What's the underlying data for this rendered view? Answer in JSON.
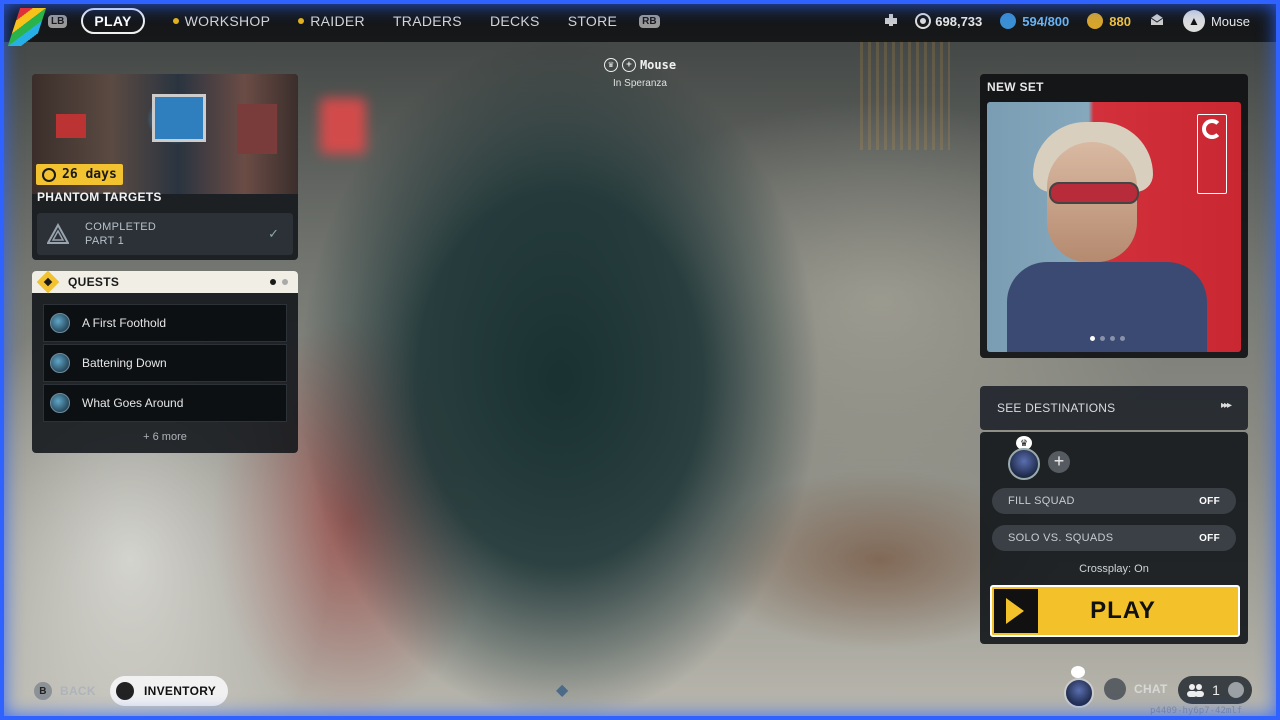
{
  "topbar": {
    "lb": "LB",
    "rb": "RB",
    "tabs": [
      {
        "label": "PLAY",
        "active": true,
        "dot": false
      },
      {
        "label": "WORKSHOP",
        "active": false,
        "dot": true
      },
      {
        "label": "RAIDER",
        "active": false,
        "dot": true
      },
      {
        "label": "TRADERS",
        "active": false,
        "dot": false
      },
      {
        "label": "DECKS",
        "active": false,
        "dot": false
      },
      {
        "label": "STORE",
        "active": false,
        "dot": false
      }
    ],
    "currencies": {
      "coins": "698,733",
      "blue": "594/800",
      "gold": "880"
    },
    "username": "Mouse"
  },
  "phantom": {
    "timer": "26 days",
    "title": "PHANTOM TARGETS",
    "status_line1": "COMPLETED",
    "status_line2": "PART 1",
    "check": "✓"
  },
  "quests": {
    "title": "QUESTS",
    "items": [
      "A First Foothold",
      "Battening Down",
      "What Goes Around"
    ],
    "more": "+ 6 more"
  },
  "center_tag": {
    "name": "Mouse",
    "location": "In Speranza"
  },
  "new_set": {
    "title": "NEW SET"
  },
  "destinations": {
    "label": "SEE DESTINATIONS",
    "arrow": "▸▸▸"
  },
  "squad": {
    "add": "+",
    "fill_squad": {
      "label": "FILL SQUAD",
      "value": "OFF"
    },
    "solo_vs_squads": {
      "label": "SOLO VS. SQUADS",
      "value": "OFF"
    },
    "crossplay": "Crossplay: On",
    "play": "PLAY"
  },
  "bottombar": {
    "back_key": "B",
    "back": "BACK",
    "inventory": "INVENTORY",
    "chat": "CHAT",
    "friends_count": "1",
    "build": "p4409-hy6p7-42mlf"
  },
  "colors": {
    "accent_yellow": "#f3c22b",
    "frame_blue": "#2f62ff",
    "blue_currency": "#6ab6f5",
    "gold_currency": "#f1c33e"
  }
}
